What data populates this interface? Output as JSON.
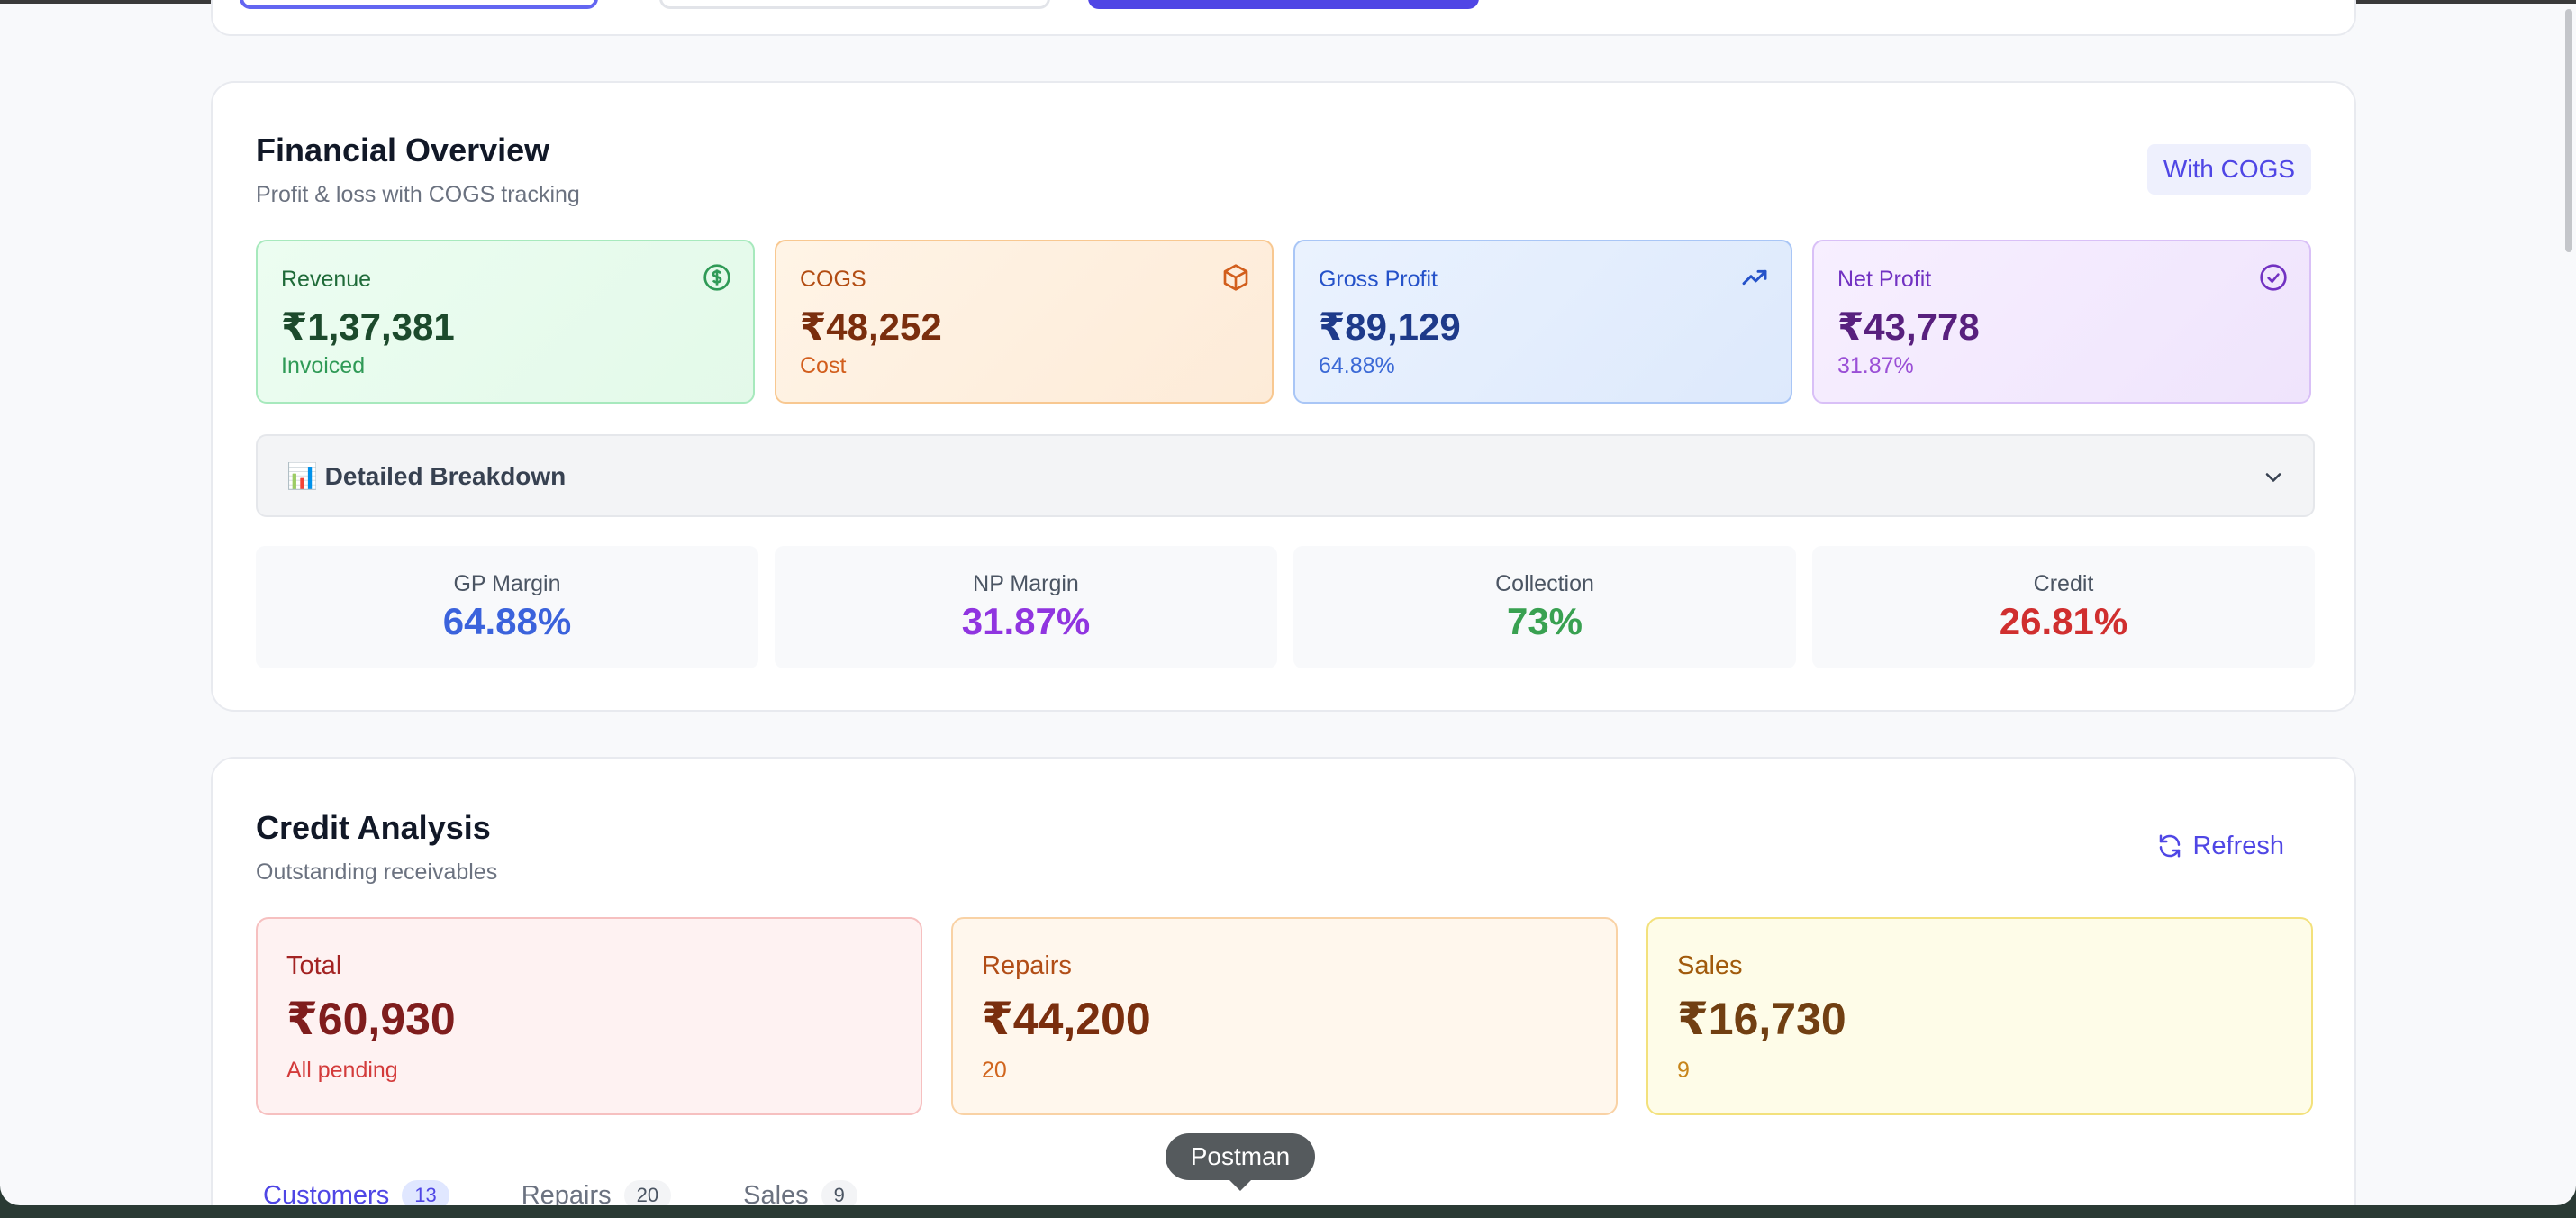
{
  "financial": {
    "title": "Financial Overview",
    "subtitle": "Profit & loss with COGS tracking",
    "badge": "With COGS",
    "stats": {
      "revenue": {
        "label": "Revenue",
        "value": "₹1,37,381",
        "sub": "Invoiced",
        "icon": "dollar-circle-icon"
      },
      "cogs": {
        "label": "COGS",
        "value": "₹48,252",
        "sub": "Cost",
        "icon": "box-icon"
      },
      "gross_profit": {
        "label": "Gross Profit",
        "value": "₹89,129",
        "sub": "64.88%",
        "icon": "trending-up-icon"
      },
      "net_profit": {
        "label": "Net Profit",
        "value": "₹43,778",
        "sub": "31.87%",
        "icon": "check-circle-icon"
      }
    },
    "breakdown": {
      "emoji": "📊",
      "label": "Detailed Breakdown"
    },
    "metrics": {
      "gp_margin": {
        "label": "GP Margin",
        "value": "64.88%"
      },
      "np_margin": {
        "label": "NP Margin",
        "value": "31.87%"
      },
      "collection": {
        "label": "Collection",
        "value": "73%"
      },
      "credit": {
        "label": "Credit",
        "value": "26.81%"
      }
    }
  },
  "credit": {
    "title": "Credit Analysis",
    "subtitle": "Outstanding receivables",
    "refresh_label": "Refresh",
    "stats": {
      "total": {
        "label": "Total",
        "value": "₹60,930",
        "sub": "All pending"
      },
      "repairs": {
        "label": "Repairs",
        "value": "₹44,200",
        "sub": "20"
      },
      "sales": {
        "label": "Sales",
        "value": "₹16,730",
        "sub": "9"
      }
    },
    "tabs": [
      {
        "label": "Customers",
        "count": "13"
      },
      {
        "label": "Repairs",
        "count": "20"
      },
      {
        "label": "Sales",
        "count": "9"
      }
    ]
  },
  "tooltip": "Postman",
  "colors": {
    "accent": "#4f46e5",
    "background": "#f8f9fb"
  }
}
